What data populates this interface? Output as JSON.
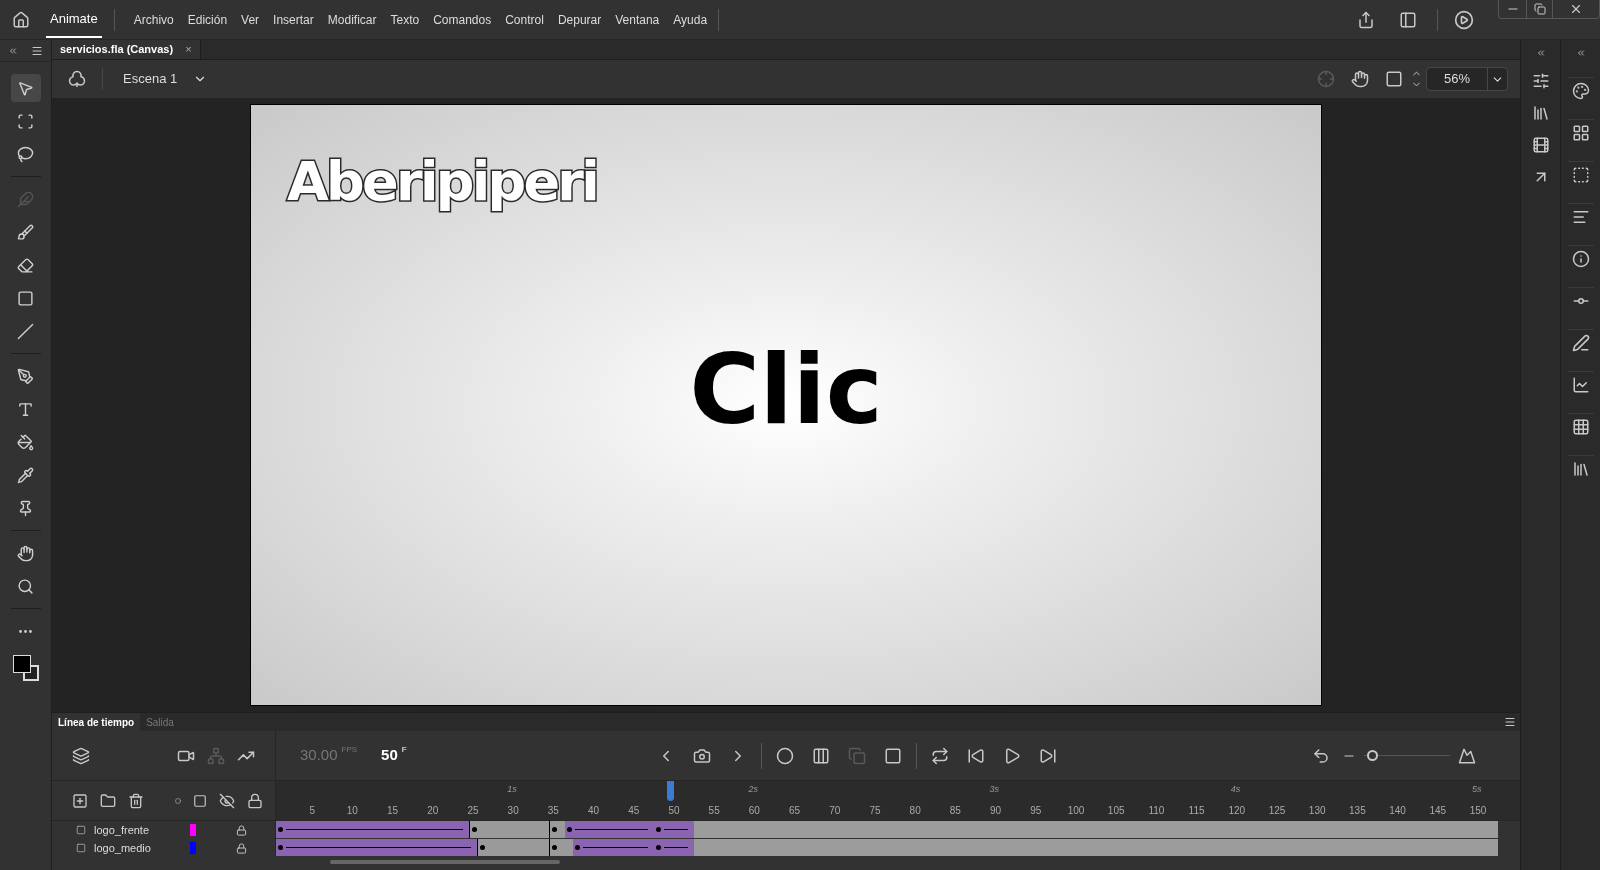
{
  "app": {
    "name": "Animate"
  },
  "menu": [
    "Archivo",
    "Edición",
    "Ver",
    "Insertar",
    "Modificar",
    "Texto",
    "Comandos",
    "Control",
    "Depurar",
    "Ventana",
    "Ayuda"
  ],
  "document_tab": {
    "title": "servicios.fla (Canvas)",
    "close": "×"
  },
  "scene": {
    "name": "Escena 1",
    "zoom": "56%"
  },
  "tools": [
    {
      "selected": true,
      "disabled": false,
      "group_end": false
    },
    {
      "selected": false,
      "disabled": false,
      "group_end": false
    },
    {
      "selected": false,
      "disabled": false,
      "group_end": true
    },
    {
      "selected": false,
      "disabled": true,
      "group_end": false
    },
    {
      "selected": false,
      "disabled": false,
      "group_end": false
    },
    {
      "selected": false,
      "disabled": false,
      "group_end": false
    },
    {
      "selected": false,
      "disabled": false,
      "group_end": false
    },
    {
      "selected": false,
      "disabled": false,
      "group_end": true
    },
    {
      "selected": false,
      "disabled": false,
      "group_end": false
    },
    {
      "selected": false,
      "disabled": false,
      "group_end": false
    },
    {
      "selected": false,
      "disabled": false,
      "group_end": false
    },
    {
      "selected": false,
      "disabled": false,
      "group_end": false
    },
    {
      "selected": false,
      "disabled": false,
      "group_end": true
    },
    {
      "selected": false,
      "disabled": false,
      "group_end": false
    },
    {
      "selected": false,
      "disabled": false,
      "group_end": true
    },
    {
      "selected": false,
      "disabled": false,
      "group_end": false
    }
  ],
  "stage": {
    "logo": "Aberipiperi",
    "headline": "Clic"
  },
  "timeline": {
    "tabs": [
      {
        "label": "Línea de tiempo",
        "selected": true
      },
      {
        "label": "Salida",
        "selected": false
      }
    ],
    "fps": "30.00",
    "fps_unit": "FPS",
    "frame": "50",
    "frame_unit": "F",
    "zoom_slider": {
      "level": 0.1
    },
    "seconds": [
      "1s",
      "2s",
      "3s",
      "4s",
      "5s"
    ],
    "ruler": [
      "5",
      "10",
      "15",
      "20",
      "25",
      "30",
      "35",
      "40",
      "45",
      "50",
      "55",
      "60",
      "65",
      "70",
      "75",
      "80",
      "85",
      "90",
      "95",
      "100",
      "105",
      "110",
      "115",
      "120",
      "125",
      "130",
      "135",
      "140",
      "145",
      "150"
    ],
    "playhead": {
      "level": 0.323
    },
    "layers": [
      {
        "name": "logo_frente",
        "color": "#ff00ff",
        "locked": true,
        "segments": [
          {
            "kind": "tween"
          },
          {
            "kind": "static"
          },
          {
            "kind": "static"
          },
          {
            "kind": "tween"
          },
          {
            "kind": "tween"
          },
          {
            "kind": "empty"
          }
        ]
      },
      {
        "name": "logo_medio",
        "color": "#0000ff",
        "locked": true,
        "segments": [
          {
            "kind": "tween"
          },
          {
            "kind": "static"
          },
          {
            "kind": "static"
          },
          {
            "kind": "tween"
          },
          {
            "kind": "tween"
          },
          {
            "kind": "empty"
          }
        ]
      }
    ]
  }
}
